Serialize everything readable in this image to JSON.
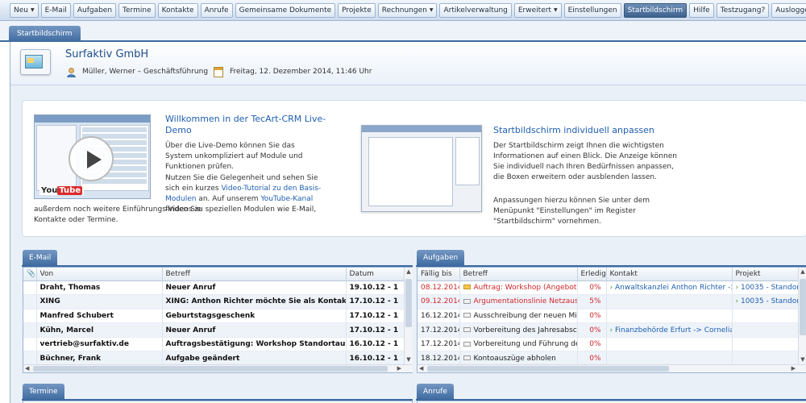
{
  "nav": [
    {
      "label": "Neu",
      "arrow": true,
      "active": false
    },
    {
      "label": "E-Mail",
      "arrow": false,
      "active": false
    },
    {
      "label": "Aufgaben",
      "arrow": false,
      "active": false
    },
    {
      "label": "Termine",
      "arrow": false,
      "active": false
    },
    {
      "label": "Kontakte",
      "arrow": false,
      "active": false
    },
    {
      "label": "Anrufe",
      "arrow": false,
      "active": false
    },
    {
      "label": "Gemeinsame Dokumente",
      "arrow": false,
      "active": false
    },
    {
      "label": "Projekte",
      "arrow": false,
      "active": false
    },
    {
      "label": "Rechnungen",
      "arrow": true,
      "active": false
    },
    {
      "label": "Artikelverwaltung",
      "arrow": false,
      "active": false
    },
    {
      "label": "Erweitert",
      "arrow": true,
      "active": false
    },
    {
      "label": "Einstellungen",
      "arrow": false,
      "active": false
    },
    {
      "label": "Startbildschirm",
      "arrow": false,
      "active": true
    },
    {
      "label": "Hilfe",
      "arrow": false,
      "active": false
    },
    {
      "label": "Testzugang?",
      "arrow": false,
      "active": false
    },
    {
      "label": "Ausloggen",
      "arrow": false,
      "active": false
    }
  ],
  "page_tab": "Startbildschirm",
  "header": {
    "company": "Surfaktiv GmbH",
    "user": "Müller, Werner – Geschäftsführung",
    "date": "Freitag, 12. Dezember 2014, 11:46 Uhr"
  },
  "welcome": {
    "title": "Willkommen in der TecArt-CRM Live-Demo",
    "p1": "Über die Live-Demo können Sie das System unkompliziert auf Module und Funktionen prüfen.",
    "p2a": "Nutzen Sie die Gelegenheit und sehen Sie sich ein kurzes ",
    "link1": "Video-Tutorial zu den Basis-Modulen",
    "p2b": " an. Auf unserem ",
    "link2": "YouTube-Kanal",
    "p2c": " finden Sie",
    "p3": "außerdem noch weitere Einführungs-Videos zu speziellen Modulen wie E-Mail, Kontakte oder Termine.",
    "yt_you": "You",
    "yt_tube": "Tube"
  },
  "customize": {
    "title": "Startbildschirm individuell anpassen",
    "p1": "Der Startbildschirm zeigt Ihnen die wichtigsten Informationen auf einen Blick. Die Anzeige können Sie individuell nach Ihren Bedürfnissen anpassen, die Boxen erweitern oder ausblenden lassen.",
    "p2": "Anpassungen hierzu können Sie unter dem Menüpunkt \"Einstellungen\" im Register \"Startbildschirm\" vornehmen."
  },
  "email": {
    "tab": "E-Mail",
    "columns": [
      "Von",
      "Betreff",
      "Datum"
    ],
    "rows": [
      {
        "from": "Draht, Thomas",
        "subject": "Neuer Anruf",
        "date": "19.10.12 - 1"
      },
      {
        "from": "XING",
        "subject": "XING: Anthon Richter möchte Sie als Kontakt",
        "date": "17.10.12 - 1"
      },
      {
        "from": "Manfred Schubert",
        "subject": "Geburtstagsgeschenk",
        "date": "17.10.12 - 1"
      },
      {
        "from": "Kühn, Marcel",
        "subject": "Neuer Anruf",
        "date": "17.10.12 - 1"
      },
      {
        "from": "vertrieb@surfaktiv.de",
        "subject": "Auftragsbestätigung: Workshop Standortausb",
        "date": "16.10.12 - 1"
      },
      {
        "from": "Büchner, Frank",
        "subject": "Aufgabe geändert",
        "date": "16.10.12 - 1"
      }
    ]
  },
  "tasks": {
    "tab": "Aufgaben",
    "columns": [
      "Fällig bis",
      "Betreff",
      "Erledigt",
      "Kontakt",
      "Projekt"
    ],
    "rows": [
      {
        "due": "08.12.2014",
        "subject": "Auftrag: Workshop (Angebot",
        "done": "0%",
        "contact": "Anwaltskanzlei Anthon Richter ->",
        "project": "10035 - Standort",
        "overdue": true,
        "folder": "open"
      },
      {
        "due": "09.12.2014",
        "subject": "Argumentationslinie Netzausb",
        "done": "5%",
        "contact": "",
        "project": "10035 - Standort",
        "overdue": true,
        "folder": "closed"
      },
      {
        "due": "16.12.2014",
        "subject": "Ausschreibung der neuen Mitarbei",
        "done": "0%",
        "contact": "",
        "project": "",
        "overdue": false,
        "folder": "closed"
      },
      {
        "due": "17.12.2014",
        "subject": "Vorbereitung des Jahresabsc",
        "done": "0%",
        "contact": "Finanzbehörde Erfurt -> Cornelia",
        "project": "",
        "overdue": false,
        "folder": "closed"
      },
      {
        "due": "17.12.2014",
        "subject": "Vorbereitung und Führung de",
        "done": "0%",
        "contact": "",
        "project": "",
        "overdue": false,
        "folder": "closed"
      },
      {
        "due": "18.12.2014",
        "subject": "Kontoauszüge abholen",
        "done": "0%",
        "contact": "",
        "project": "",
        "overdue": false,
        "folder": "closed"
      }
    ]
  },
  "termine": {
    "tab": "Termine"
  },
  "anrufe": {
    "tab": "Anrufe"
  },
  "icons": {
    "user": "user-icon",
    "calendar": "calendar-icon",
    "attachment": "paperclip-icon",
    "play": "play-icon"
  },
  "colors": {
    "accent": "#3d6aa0",
    "link": "#1f5fb0",
    "overdue": "#d0282b"
  }
}
